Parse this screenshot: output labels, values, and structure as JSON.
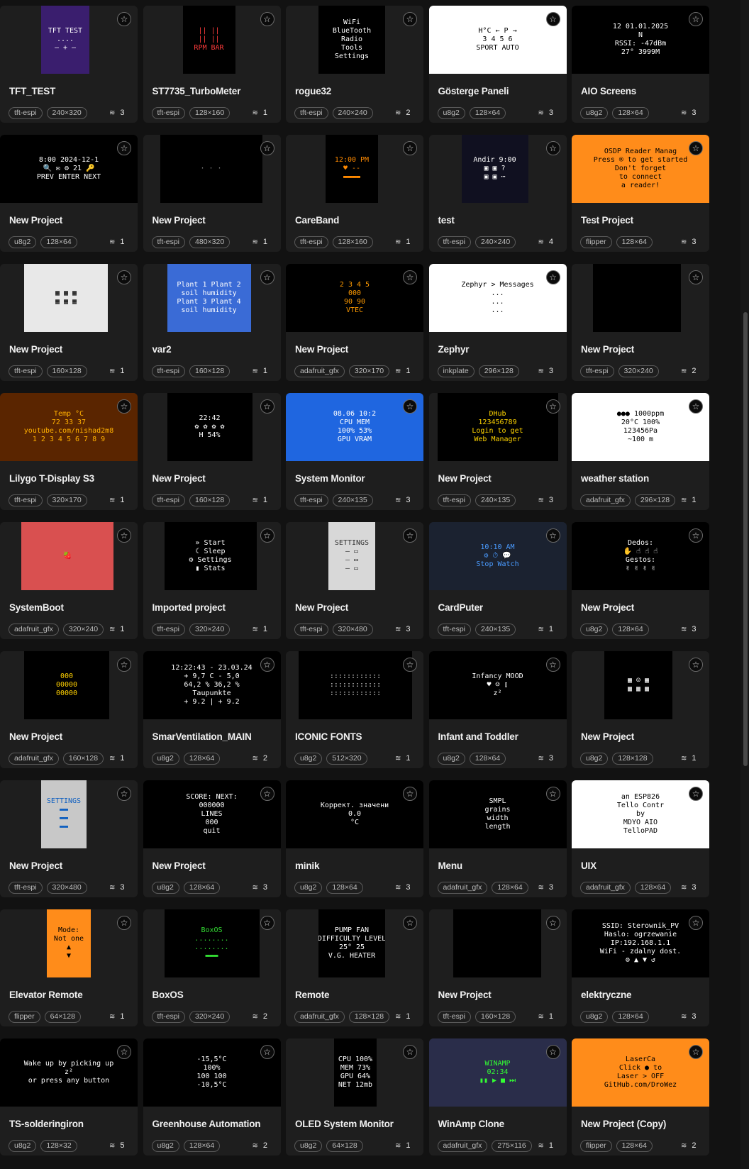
{
  "projects": [
    {
      "title": "TFT_TEST",
      "library": "tft-espi",
      "resolution": "240×320",
      "screens": "3",
      "thumb": {
        "lines": [
          "TFT TEST",
          "....",
          "— + —"
        ],
        "bg": "#3a1e6e",
        "fg": "#ffffff"
      }
    },
    {
      "title": "ST7735_TurboMeter",
      "library": "tft-espi",
      "resolution": "128×160",
      "screens": "1",
      "thumb": {
        "lines": [
          "||  ||",
          "|| ||",
          "RPM BAR"
        ],
        "bg": "#000000",
        "fg": "#ff3b3b"
      }
    },
    {
      "title": "rogue32",
      "library": "tft-espi",
      "resolution": "240×240",
      "screens": "2",
      "thumb": {
        "lines": [
          "WiFi",
          "BlueTooth",
          "Radio",
          "Tools",
          "Settings"
        ],
        "bg": "#000000",
        "fg": "#ffffff"
      }
    },
    {
      "title": "Gösterge Paneli",
      "library": "u8g2",
      "resolution": "128×64",
      "screens": "3",
      "thumb": {
        "lines": [
          "H°C  ← P →",
          "3 4 5 6",
          "SPORT  AUTO"
        ],
        "bg": "#ffffff",
        "fg": "#000000"
      }
    },
    {
      "title": "AIO Screens",
      "library": "u8g2",
      "resolution": "128×64",
      "screens": "3",
      "thumb": {
        "lines": [
          "12  01.01.2025",
          "N",
          "RSSI: -47dBm",
          "27°  3999M"
        ],
        "bg": "#000000",
        "fg": "#ffffff"
      }
    },
    {
      "title": "New Project",
      "library": "u8g2",
      "resolution": "128×64",
      "screens": "1",
      "thumb": {
        "lines": [
          "8:00   2024-12-1",
          "🔍 ✉ ⚙ 21 🔑",
          "PREV ENTER NEXT"
        ],
        "bg": "#000000",
        "fg": "#ffffff"
      }
    },
    {
      "title": "New Project",
      "library": "tft-espi",
      "resolution": "480×320",
      "screens": "1",
      "thumb": {
        "lines": [
          "",
          "· · ·",
          ""
        ],
        "bg": "#000000",
        "fg": "#888888"
      }
    },
    {
      "title": "CareBand",
      "library": "tft-espi",
      "resolution": "128×160",
      "screens": "1",
      "thumb": {
        "lines": [
          "12:00 PM",
          "♥ --",
          "▬▬▬▬"
        ],
        "bg": "#000000",
        "fg": "#ff8a00"
      }
    },
    {
      "title": "test",
      "library": "tft-espi",
      "resolution": "240×240",
      "screens": "4",
      "thumb": {
        "lines": [
          "Andir  9:00",
          "▣ ▣ ?",
          "▣ ▣ ⋯"
        ],
        "bg": "#101020",
        "fg": "#ffffff"
      }
    },
    {
      "title": "Test Project",
      "library": "flipper",
      "resolution": "128×64",
      "screens": "3",
      "thumb": {
        "lines": [
          "OSDP Reader Manag",
          "Press ® to get started",
          "Don't forget",
          "to connect",
          "a reader!"
        ],
        "bg": "#ff8c1a",
        "fg": "#000000"
      }
    },
    {
      "title": "New Project",
      "library": "tft-espi",
      "resolution": "160×128",
      "screens": "1",
      "thumb": {
        "lines": [
          "▦ ▦ ▦",
          "▦ ▦ ▦"
        ],
        "bg": "#e8e8e8",
        "fg": "#000000"
      }
    },
    {
      "title": "var2",
      "library": "tft-espi",
      "resolution": "160×128",
      "screens": "1",
      "thumb": {
        "lines": [
          "Plant 1  Plant 2",
          "soil humidity",
          "Plant 3  Plant 4",
          "soil humidity"
        ],
        "bg": "#3a6bd6",
        "fg": "#ffffff"
      }
    },
    {
      "title": "New Project",
      "library": "adafruit_gfx",
      "resolution": "320×170",
      "screens": "1",
      "thumb": {
        "lines": [
          "2 3 4 5",
          "000",
          "90 90",
          "VTEC"
        ],
        "bg": "#000000",
        "fg": "#ff9a00"
      }
    },
    {
      "title": "Zephyr",
      "library": "inkplate",
      "resolution": "296×128",
      "screens": "3",
      "thumb": {
        "lines": [
          "Zephyr > Messages",
          "...",
          "...",
          "..."
        ],
        "bg": "#ffffff",
        "fg": "#000000"
      }
    },
    {
      "title": "New Project",
      "library": "tft-espi",
      "resolution": "320×240",
      "screens": "2",
      "thumb": {
        "lines": [
          ""
        ],
        "bg": "#000000",
        "fg": "#000000"
      }
    },
    {
      "title": "Lilygo T-Display S3",
      "library": "tft-espi",
      "resolution": "320×170",
      "screens": "1",
      "thumb": {
        "lines": [
          "Temp °C",
          "72 33 37",
          "youtube.com/nishad2m8",
          "1 2 3 4 5 6 7 8 9"
        ],
        "bg": "#5a2500",
        "fg": "#ffb000"
      }
    },
    {
      "title": "New Project",
      "library": "tft-espi",
      "resolution": "160×128",
      "screens": "1",
      "thumb": {
        "lines": [
          "22:42",
          "✿ ✿ ✿ ✿",
          "H 54%"
        ],
        "bg": "#000000",
        "fg": "#ffffff"
      }
    },
    {
      "title": "System Monitor",
      "library": "tft-espi",
      "resolution": "240×135",
      "screens": "3",
      "thumb": {
        "lines": [
          "08.06   10:2",
          "CPU   MEM",
          "100%  53%",
          "GPU  VRAM"
        ],
        "bg": "#1f66e0",
        "fg": "#ffffff"
      }
    },
    {
      "title": "New Project",
      "library": "tft-espi",
      "resolution": "240×135",
      "screens": "3",
      "thumb": {
        "lines": [
          "DHub",
          "123456789",
          "Login to get",
          "Web Manager"
        ],
        "bg": "#000000",
        "fg": "#ffd400"
      }
    },
    {
      "title": "weather station",
      "library": "adafruit_gfx",
      "resolution": "296×128",
      "screens": "1",
      "thumb": {
        "lines": [
          "●●● 1000ppm",
          "20°C  100%",
          "123456Pa",
          "~100 m"
        ],
        "bg": "#ffffff",
        "fg": "#000000"
      }
    },
    {
      "title": "SystemBoot",
      "library": "adafruit_gfx",
      "resolution": "320×240",
      "screens": "1",
      "thumb": {
        "lines": [
          "🍓"
        ],
        "bg": "#d95050",
        "fg": "#ffffff"
      }
    },
    {
      "title": "Imported project",
      "library": "tft-espi",
      "resolution": "320×240",
      "screens": "1",
      "thumb": {
        "lines": [
          "» Start",
          "☾ Sleep",
          "⚙ Settings",
          "▮ Stats"
        ],
        "bg": "#000000",
        "fg": "#ffffff"
      }
    },
    {
      "title": "New Project",
      "library": "tft-espi",
      "resolution": "320×480",
      "screens": "3",
      "thumb": {
        "lines": [
          "SETTINGS",
          "— ▭",
          "— ▭",
          "— ▭"
        ],
        "bg": "#d8d8d8",
        "fg": "#333333"
      }
    },
    {
      "title": "CardPuter",
      "library": "tft-espi",
      "resolution": "240×135",
      "screens": "1",
      "thumb": {
        "lines": [
          "10:10 AM",
          "⚙ ⏱ 💬",
          "Stop Watch"
        ],
        "bg": "#1b2230",
        "fg": "#4a9bff"
      }
    },
    {
      "title": "New Project",
      "library": "u8g2",
      "resolution": "128×64",
      "screens": "3",
      "thumb": {
        "lines": [
          "Dedos:",
          "✋ ☝ ☝ ☝",
          "Gestos:",
          "✌ ✌ ✌ ✌"
        ],
        "bg": "#000000",
        "fg": "#ffffff"
      }
    },
    {
      "title": "New Project",
      "library": "adafruit_gfx",
      "resolution": "160×128",
      "screens": "1",
      "thumb": {
        "lines": [
          "000",
          "00000",
          "00000"
        ],
        "bg": "#000000",
        "fg": "#ffd000"
      }
    },
    {
      "title": "SmarVentilation_MAIN",
      "library": "u8g2",
      "resolution": "128×64",
      "screens": "2",
      "thumb": {
        "lines": [
          "12:22:43 - 23.03.24",
          "+ 9,7 C  - 5,0",
          "64,2 %  36,2 %",
          "Taupunkte",
          "+ 9.2 | + 9.2"
        ],
        "bg": "#000000",
        "fg": "#ffffff"
      }
    },
    {
      "title": "ICONIC FONTS",
      "library": "u8g2",
      "resolution": "512×320",
      "screens": "1",
      "thumb": {
        "lines": [
          "::::::::::::",
          "::::::::::::",
          "::::::::::::"
        ],
        "bg": "#000000",
        "fg": "#dddddd"
      }
    },
    {
      "title": "Infant and Toddler",
      "library": "u8g2",
      "resolution": "128×64",
      "screens": "3",
      "thumb": {
        "lines": [
          "Infancy  MOOD",
          "♥  ☺  ▯",
          "z²"
        ],
        "bg": "#000000",
        "fg": "#ffffff"
      }
    },
    {
      "title": "New Project",
      "library": "u8g2",
      "resolution": "128×128",
      "screens": "1",
      "thumb": {
        "lines": [
          "▦ ☺ ▦",
          "▦ ▦ ▦"
        ],
        "bg": "#000000",
        "fg": "#ffffff"
      }
    },
    {
      "title": "New Project",
      "library": "tft-espi",
      "resolution": "320×480",
      "screens": "3",
      "thumb": {
        "lines": [
          "SETTINGS",
          "▬▬",
          "▬▬",
          "▬▬"
        ],
        "bg": "#c8c8c8",
        "fg": "#1060c0"
      }
    },
    {
      "title": "New Project",
      "library": "u8g2",
      "resolution": "128×64",
      "screens": "3",
      "thumb": {
        "lines": [
          "SCORE:  NEXT:",
          "000000",
          "LINES",
          "000",
          "quit"
        ],
        "bg": "#000000",
        "fg": "#ffffff"
      }
    },
    {
      "title": "minik",
      "library": "u8g2",
      "resolution": "128×64",
      "screens": "3",
      "thumb": {
        "lines": [
          "Коррект. значени",
          "0.0",
          "°C"
        ],
        "bg": "#000000",
        "fg": "#ffffff"
      }
    },
    {
      "title": "Menu",
      "library": "adafruit_gfx",
      "resolution": "128×64",
      "screens": "3",
      "thumb": {
        "lines": [
          "SMPL",
          "grains",
          "width",
          "length"
        ],
        "bg": "#000000",
        "fg": "#ffffff"
      }
    },
    {
      "title": "UIX",
      "library": "adafruit_gfx",
      "resolution": "128×64",
      "screens": "3",
      "thumb": {
        "lines": [
          "an ESP826",
          "Tello Contr",
          "by",
          "MDYO AIO",
          "TelloPAD"
        ],
        "bg": "#ffffff",
        "fg": "#000000"
      }
    },
    {
      "title": "Elevator Remote",
      "library": "flipper",
      "resolution": "64×128",
      "screens": "1",
      "thumb": {
        "lines": [
          "Mode:",
          "Not one",
          "▲",
          "▼"
        ],
        "bg": "#ff8c1a",
        "fg": "#000000"
      }
    },
    {
      "title": "BoxOS",
      "library": "tft-espi",
      "resolution": "320×240",
      "screens": "2",
      "thumb": {
        "lines": [
          "BoxOS",
          "........",
          "........",
          "▬▬▬"
        ],
        "bg": "#000000",
        "fg": "#33dd33"
      }
    },
    {
      "title": "Remote",
      "library": "adafruit_gfx",
      "resolution": "128×128",
      "screens": "1",
      "thumb": {
        "lines": [
          "PUMP  FAN",
          "DIFFICULTY LEVEL",
          "25°  25",
          "V.G.  HEATER"
        ],
        "bg": "#000000",
        "fg": "#ffffff"
      }
    },
    {
      "title": "New Project",
      "library": "tft-espi",
      "resolution": "160×128",
      "screens": "1",
      "thumb": {
        "lines": [
          ""
        ],
        "bg": "#000000",
        "fg": "#000000"
      }
    },
    {
      "title": "elektryczne",
      "library": "u8g2",
      "resolution": "128×64",
      "screens": "3",
      "thumb": {
        "lines": [
          "SSID: Sterownik_PV",
          "Haslo: ogrzewanie",
          "IP:192.168.1.1",
          "WiFi - zdalny dost.",
          "⚙ ▲ ▼ ↺"
        ],
        "bg": "#000000",
        "fg": "#ffffff"
      }
    },
    {
      "title": "TS-solderingiron",
      "library": "u8g2",
      "resolution": "128×32",
      "screens": "5",
      "thumb": {
        "lines": [
          "Wake up by picking up",
          "z²",
          "or press any button"
        ],
        "bg": "#000000",
        "fg": "#ffffff"
      }
    },
    {
      "title": "Greenhouse Automation",
      "library": "u8g2",
      "resolution": "128×64",
      "screens": "2",
      "thumb": {
        "lines": [
          "-15,5°C",
          "100%",
          "100  100",
          "-10,5°C"
        ],
        "bg": "#000000",
        "fg": "#ffffff"
      }
    },
    {
      "title": "OLED System Monitor",
      "library": "u8g2",
      "resolution": "64×128",
      "screens": "1",
      "thumb": {
        "lines": [
          "CPU 100%",
          "MEM 73%",
          "GPU 64%",
          "NET 12mb"
        ],
        "bg": "#000000",
        "fg": "#ffffff"
      }
    },
    {
      "title": "WinAmp Clone",
      "library": "adafruit_gfx",
      "resolution": "275×116",
      "screens": "1",
      "thumb": {
        "lines": [
          "WINAMP",
          "02:34",
          "▮▮ ▶ ■ ⏭"
        ],
        "bg": "#2a2d4a",
        "fg": "#33ff33"
      }
    },
    {
      "title": "New Project (Copy)",
      "library": "flipper",
      "resolution": "128×64",
      "screens": "2",
      "thumb": {
        "lines": [
          "LaserCa",
          "Click  ● to",
          "Laser > OFF",
          "GitHub.com/DroWez"
        ],
        "bg": "#ff8c1a",
        "fg": "#000000"
      }
    }
  ],
  "icons": {
    "star": "star-icon",
    "screens": "layers-icon"
  }
}
